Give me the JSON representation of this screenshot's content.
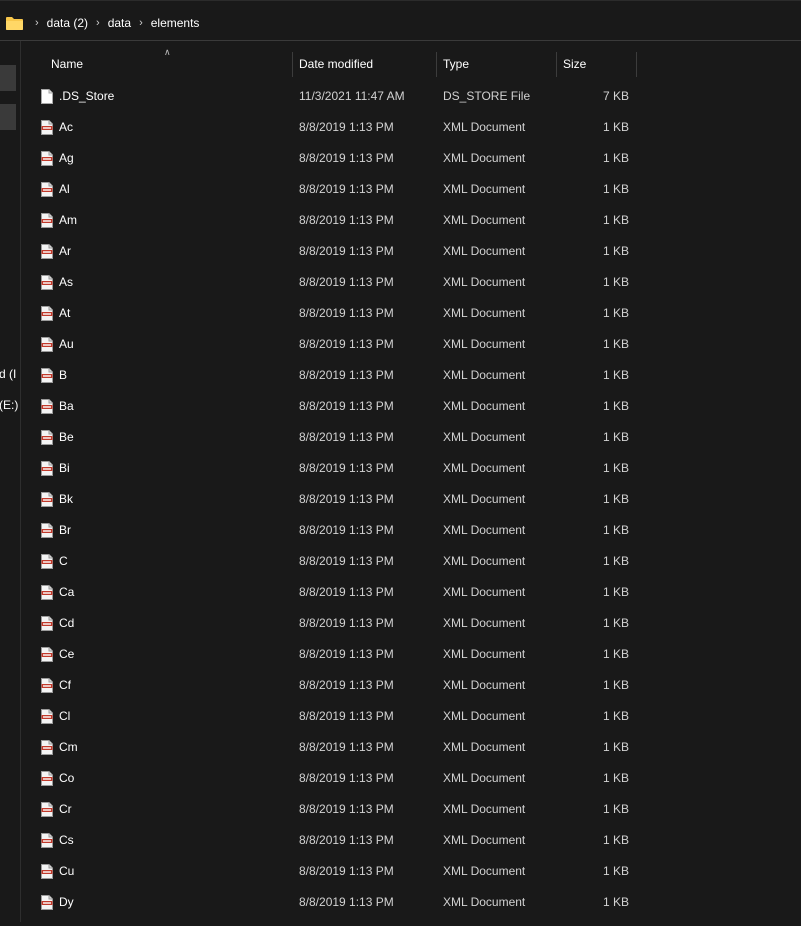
{
  "breadcrumb": [
    "data (2)",
    "data",
    "elements"
  ],
  "sidebar": {
    "partial_labels": [
      "d (I",
      "(E:)"
    ]
  },
  "columns": {
    "name": "Name",
    "date": "Date modified",
    "type": "Type",
    "size": "Size"
  },
  "colors": {
    "folder": "#f8c74b",
    "background": "#191919",
    "xml_icon_accent": "#c0392b"
  },
  "files": [
    {
      "name": ".DS_Store",
      "date": "11/3/2021 11:47 AM",
      "type": "DS_STORE File",
      "size": "7 KB",
      "icon": "blank-file-icon"
    },
    {
      "name": "Ac",
      "date": "8/8/2019 1:13 PM",
      "type": "XML Document",
      "size": "1 KB",
      "icon": "xml-file-icon"
    },
    {
      "name": "Ag",
      "date": "8/8/2019 1:13 PM",
      "type": "XML Document",
      "size": "1 KB",
      "icon": "xml-file-icon"
    },
    {
      "name": "Al",
      "date": "8/8/2019 1:13 PM",
      "type": "XML Document",
      "size": "1 KB",
      "icon": "xml-file-icon"
    },
    {
      "name": "Am",
      "date": "8/8/2019 1:13 PM",
      "type": "XML Document",
      "size": "1 KB",
      "icon": "xml-file-icon"
    },
    {
      "name": "Ar",
      "date": "8/8/2019 1:13 PM",
      "type": "XML Document",
      "size": "1 KB",
      "icon": "xml-file-icon"
    },
    {
      "name": "As",
      "date": "8/8/2019 1:13 PM",
      "type": "XML Document",
      "size": "1 KB",
      "icon": "xml-file-icon"
    },
    {
      "name": "At",
      "date": "8/8/2019 1:13 PM",
      "type": "XML Document",
      "size": "1 KB",
      "icon": "xml-file-icon"
    },
    {
      "name": "Au",
      "date": "8/8/2019 1:13 PM",
      "type": "XML Document",
      "size": "1 KB",
      "icon": "xml-file-icon"
    },
    {
      "name": "B",
      "date": "8/8/2019 1:13 PM",
      "type": "XML Document",
      "size": "1 KB",
      "icon": "xml-file-icon"
    },
    {
      "name": "Ba",
      "date": "8/8/2019 1:13 PM",
      "type": "XML Document",
      "size": "1 KB",
      "icon": "xml-file-icon"
    },
    {
      "name": "Be",
      "date": "8/8/2019 1:13 PM",
      "type": "XML Document",
      "size": "1 KB",
      "icon": "xml-file-icon"
    },
    {
      "name": "Bi",
      "date": "8/8/2019 1:13 PM",
      "type": "XML Document",
      "size": "1 KB",
      "icon": "xml-file-icon"
    },
    {
      "name": "Bk",
      "date": "8/8/2019 1:13 PM",
      "type": "XML Document",
      "size": "1 KB",
      "icon": "xml-file-icon"
    },
    {
      "name": "Br",
      "date": "8/8/2019 1:13 PM",
      "type": "XML Document",
      "size": "1 KB",
      "icon": "xml-file-icon"
    },
    {
      "name": "C",
      "date": "8/8/2019 1:13 PM",
      "type": "XML Document",
      "size": "1 KB",
      "icon": "xml-file-icon"
    },
    {
      "name": "Ca",
      "date": "8/8/2019 1:13 PM",
      "type": "XML Document",
      "size": "1 KB",
      "icon": "xml-file-icon"
    },
    {
      "name": "Cd",
      "date": "8/8/2019 1:13 PM",
      "type": "XML Document",
      "size": "1 KB",
      "icon": "xml-file-icon"
    },
    {
      "name": "Ce",
      "date": "8/8/2019 1:13 PM",
      "type": "XML Document",
      "size": "1 KB",
      "icon": "xml-file-icon"
    },
    {
      "name": "Cf",
      "date": "8/8/2019 1:13 PM",
      "type": "XML Document",
      "size": "1 KB",
      "icon": "xml-file-icon"
    },
    {
      "name": "Cl",
      "date": "8/8/2019 1:13 PM",
      "type": "XML Document",
      "size": "1 KB",
      "icon": "xml-file-icon"
    },
    {
      "name": "Cm",
      "date": "8/8/2019 1:13 PM",
      "type": "XML Document",
      "size": "1 KB",
      "icon": "xml-file-icon"
    },
    {
      "name": "Co",
      "date": "8/8/2019 1:13 PM",
      "type": "XML Document",
      "size": "1 KB",
      "icon": "xml-file-icon"
    },
    {
      "name": "Cr",
      "date": "8/8/2019 1:13 PM",
      "type": "XML Document",
      "size": "1 KB",
      "icon": "xml-file-icon"
    },
    {
      "name": "Cs",
      "date": "8/8/2019 1:13 PM",
      "type": "XML Document",
      "size": "1 KB",
      "icon": "xml-file-icon"
    },
    {
      "name": "Cu",
      "date": "8/8/2019 1:13 PM",
      "type": "XML Document",
      "size": "1 KB",
      "icon": "xml-file-icon"
    },
    {
      "name": "Dy",
      "date": "8/8/2019 1:13 PM",
      "type": "XML Document",
      "size": "1 KB",
      "icon": "xml-file-icon"
    }
  ]
}
